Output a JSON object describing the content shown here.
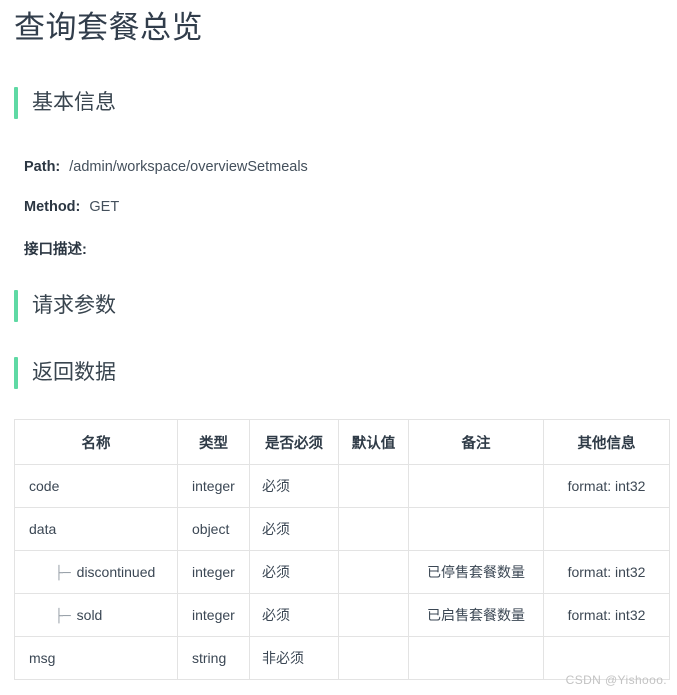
{
  "page": {
    "title": "查询套餐总览",
    "watermark": "CSDN @Yishooo."
  },
  "accent_color": "#5fd9a4",
  "sections": {
    "basic": "基本信息",
    "request_params": "请求参数",
    "return_data": "返回数据"
  },
  "basic_info": {
    "path_label": "Path:",
    "path_value": "/admin/workspace/overviewSetmeals",
    "method_label": "Method:",
    "method_value": "GET",
    "description_label": "接口描述:",
    "description_value": ""
  },
  "return_table": {
    "columns": [
      "名称",
      "类型",
      "是否必须",
      "默认值",
      "备注",
      "其他信息"
    ],
    "rows": [
      {
        "prefix": "",
        "name": "code",
        "type": "integer",
        "required": "必须",
        "default": "",
        "remark": "",
        "extra": "format: int32"
      },
      {
        "prefix": "",
        "name": "data",
        "type": "object",
        "required": "必须",
        "default": "",
        "remark": "",
        "extra": ""
      },
      {
        "prefix": "├─",
        "name": "discontinued",
        "type": "integer",
        "required": "必须",
        "default": "",
        "remark": "已停售套餐数量",
        "extra": "format: int32"
      },
      {
        "prefix": "├─",
        "name": "sold",
        "type": "integer",
        "required": "必须",
        "default": "",
        "remark": "已启售套餐数量",
        "extra": "format: int32"
      },
      {
        "prefix": "",
        "name": "msg",
        "type": "string",
        "required": "非必须",
        "default": "",
        "remark": "",
        "extra": ""
      }
    ]
  }
}
